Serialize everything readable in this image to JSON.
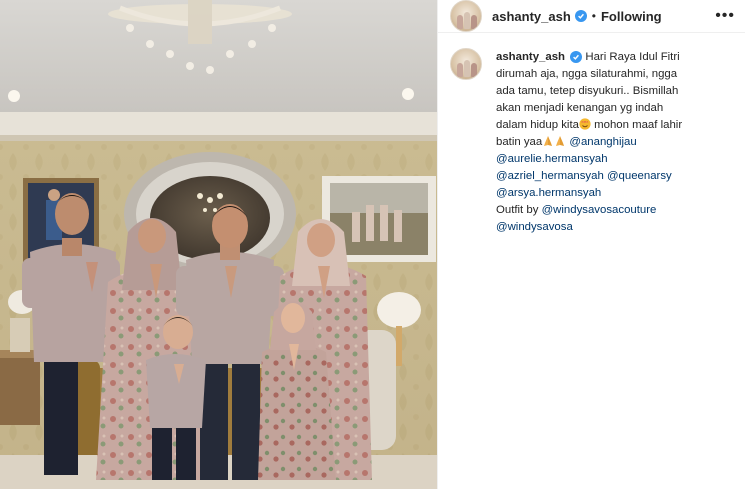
{
  "post": {
    "username": "ashanty_ash",
    "follow_status": "Following",
    "more_icon": "more-options-icon",
    "caption": {
      "author": "ashanty_ash",
      "line1": "Hari Raya Idul Fitri",
      "line2": "dirumah aja, ngga silaturahmi, ngga",
      "line3": "ada tamu, tetep disyukuri.. Bismillah",
      "line4": "akan menjadi kenangan yg indah",
      "line5": "dalam hidup kita",
      "line5b": " mohon maaf lahir",
      "line6": "batin yaa",
      "mentions": [
        "@ananghijau",
        "@aurelie.hermansyah",
        "@azriel_hermansyah",
        "@queenarsy",
        "@arsya.hermansyah"
      ],
      "outfit_label": "Outfit by ",
      "outfit_mentions": [
        "@windysavosacouture",
        "@windysavosa"
      ]
    }
  },
  "colors": {
    "mention": "#00376b",
    "verified": "#3897f0",
    "text": "#262626"
  }
}
